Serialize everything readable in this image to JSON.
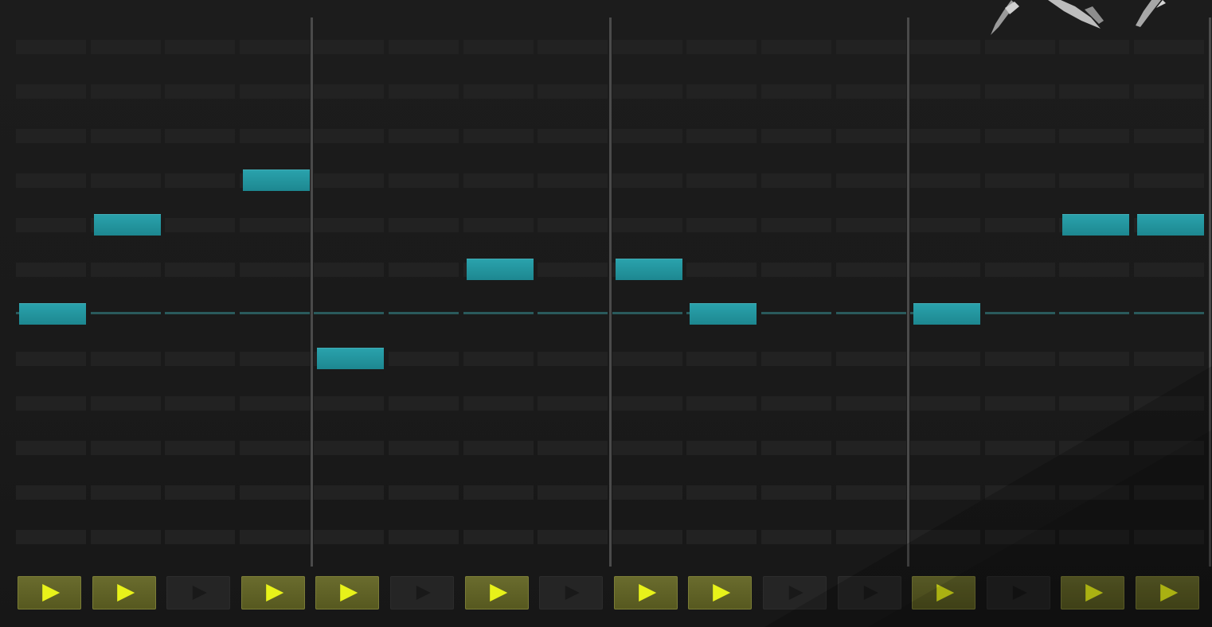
{
  "sequencer": {
    "steps": 16,
    "rows": 12,
    "root_row": 6,
    "bar_every": 4,
    "notes": [
      {
        "step": 0,
        "row": 6
      },
      {
        "step": 1,
        "row": 4
      },
      {
        "step": 3,
        "row": 3
      },
      {
        "step": 4,
        "row": 7
      },
      {
        "step": 6,
        "row": 5
      },
      {
        "step": 8,
        "row": 5
      },
      {
        "step": 9,
        "row": 6
      },
      {
        "step": 12,
        "row": 6
      },
      {
        "step": 14,
        "row": 4
      },
      {
        "step": 15,
        "row": 4
      }
    ],
    "gates": [
      true,
      true,
      false,
      true,
      true,
      false,
      true,
      false,
      true,
      true,
      false,
      false,
      true,
      false,
      true,
      true
    ]
  },
  "icons": {
    "gate_on": "play-icon",
    "gate_off": "play-icon-dimmed",
    "logo": "brush-logo"
  },
  "colors": {
    "note": "#1f939c",
    "gate_on": "#5f6227",
    "gate_arrow": "#e8f21a",
    "root_line": "#2a5a5c",
    "bar_line": "#4a4a4a"
  }
}
